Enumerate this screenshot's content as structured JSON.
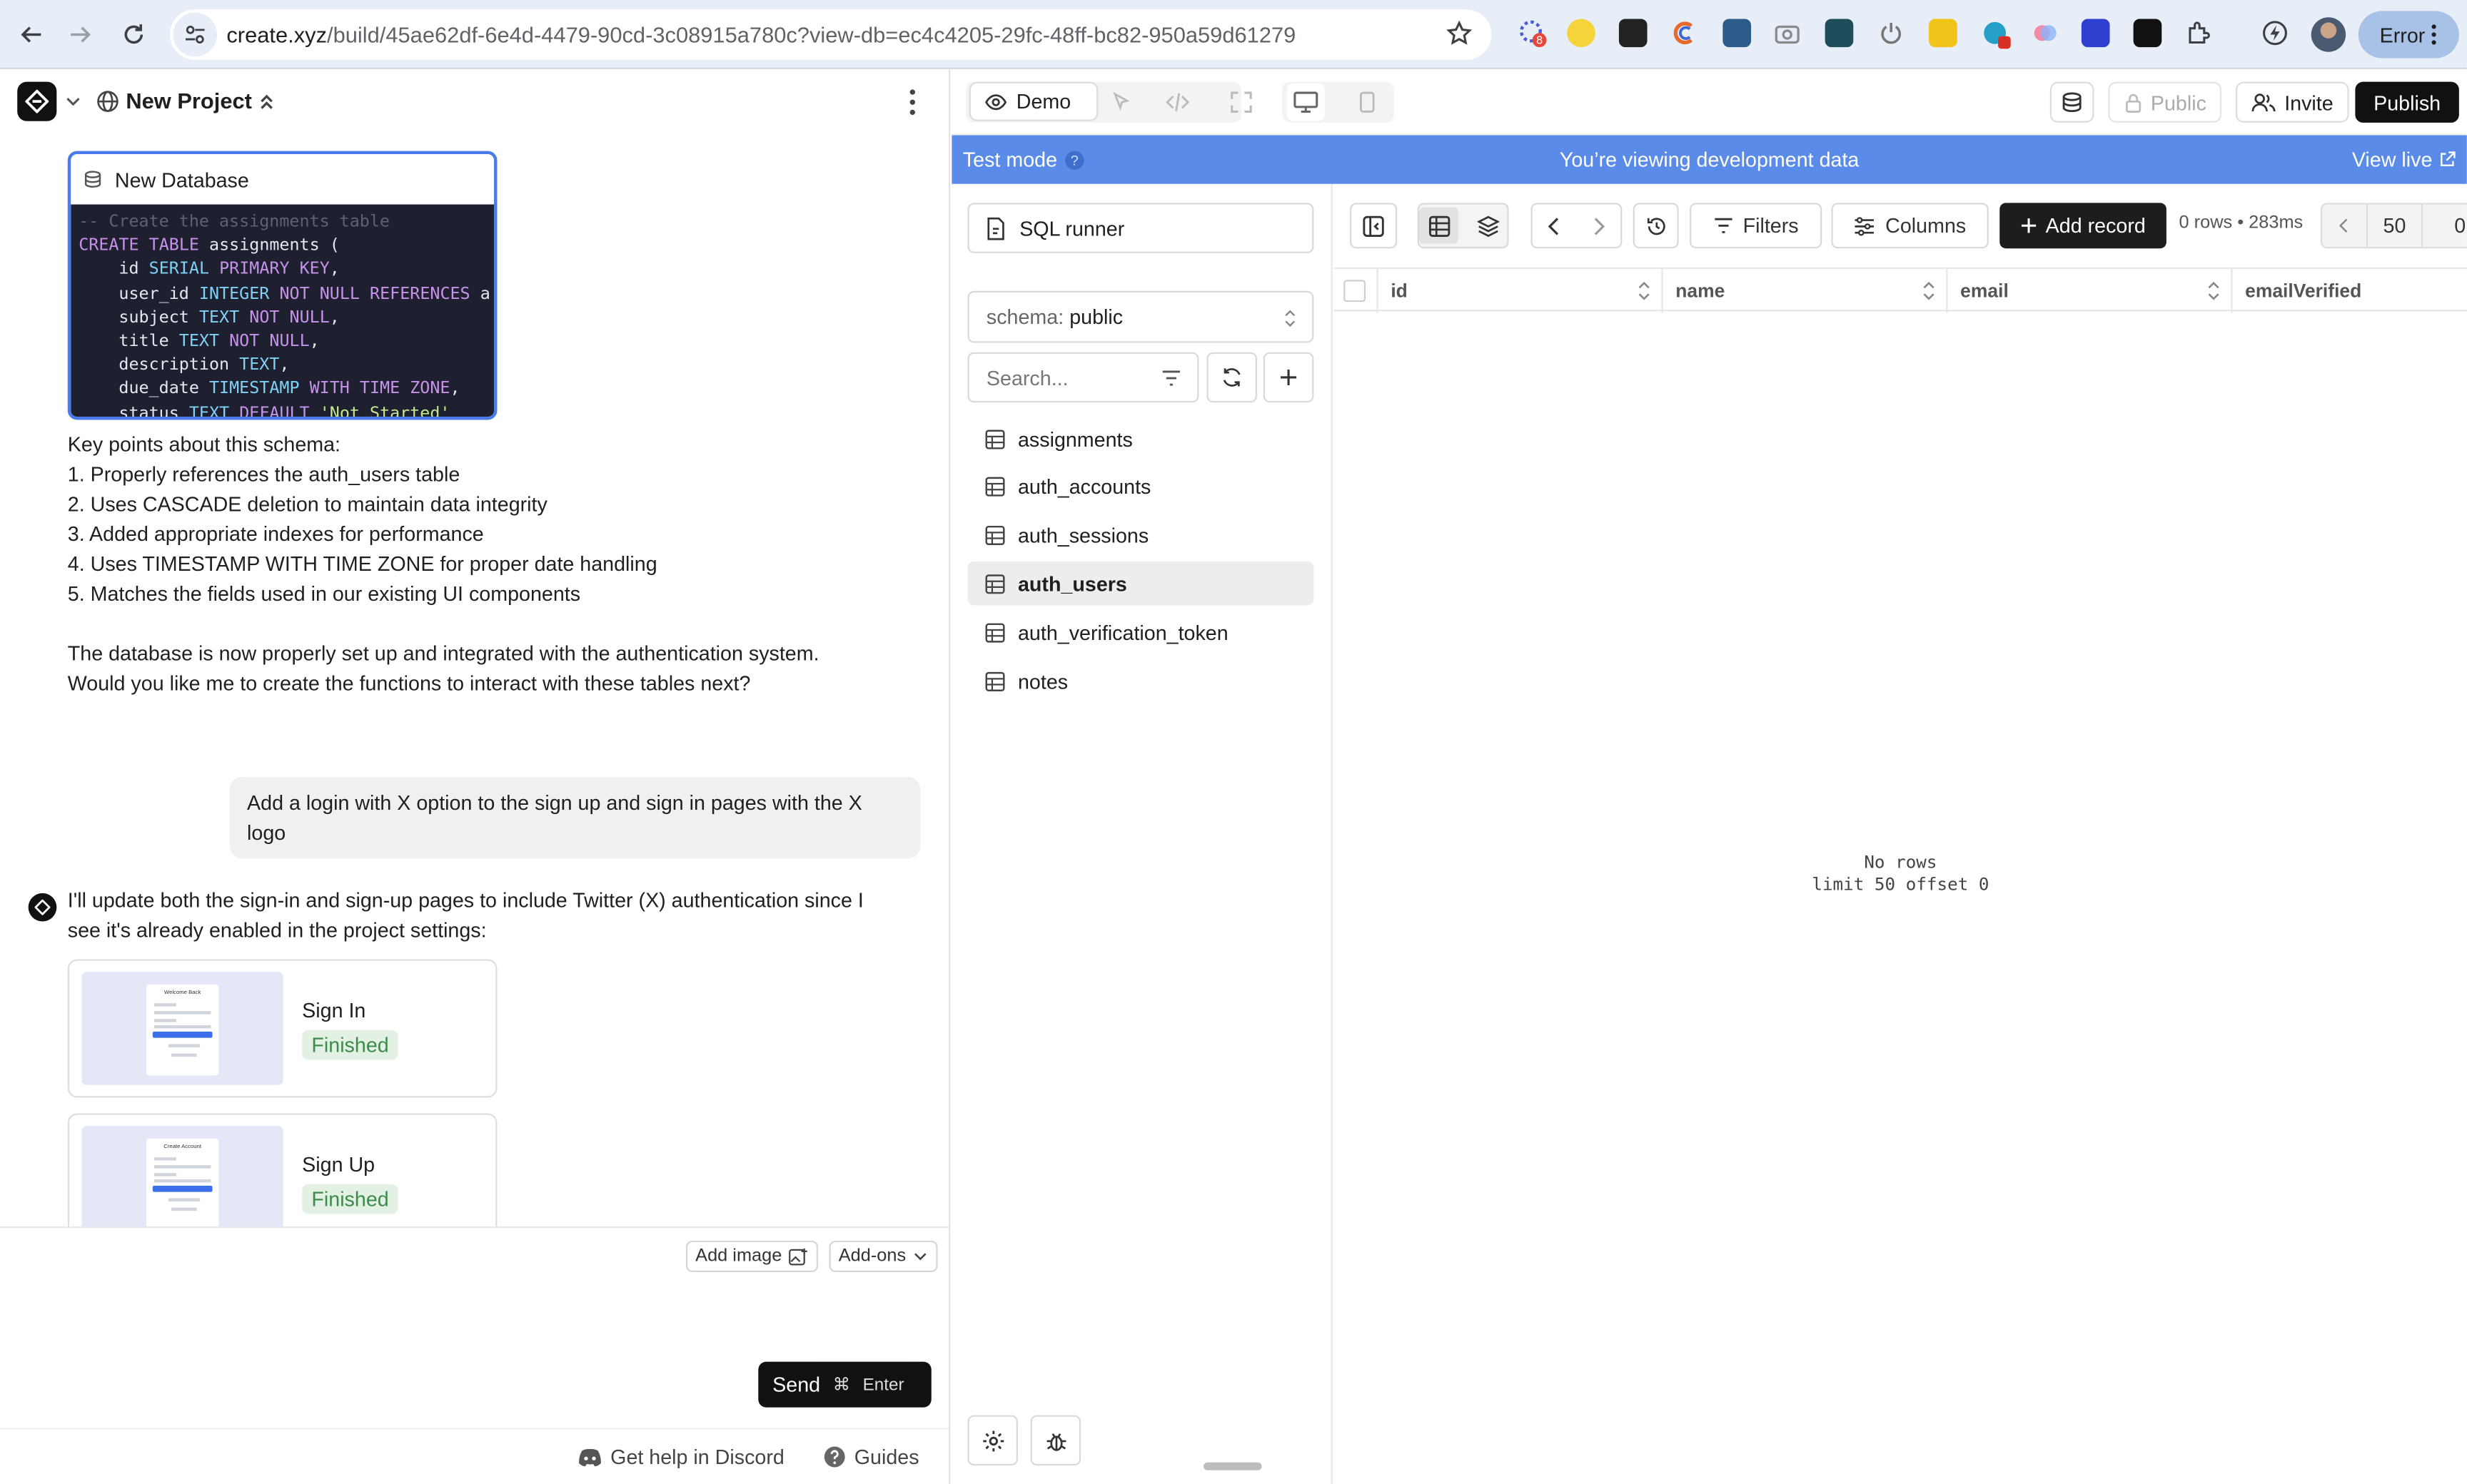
{
  "browser": {
    "url_domain": "create.xyz",
    "url_rest": "/build/45ae62df-6e4d-4479-90cd-3c08915a780c?view-db=ec4c4205-29fc-48ff-bc82-950a59d61279",
    "extension_badge": "8",
    "error_label": "Error"
  },
  "project": {
    "name": "New Project"
  },
  "chat": {
    "db_card_title": "New Database",
    "code_lines": [
      {
        "c": "cm",
        "t": "-- Create the assignments table"
      },
      {
        "c": "",
        "t": "CREATE TABLE assignments ("
      },
      {
        "c": "",
        "t": "    id SERIAL PRIMARY KEY,"
      },
      {
        "c": "",
        "t": "    user_id INTEGER NOT NULL REFERENCES a"
      },
      {
        "c": "",
        "t": "    subject TEXT NOT NULL,"
      },
      {
        "c": "",
        "t": "    title TEXT NOT NULL,"
      },
      {
        "c": "",
        "t": "    description TEXT,"
      },
      {
        "c": "",
        "t": "    due_date TIMESTAMP WITH TIME ZONE,"
      },
      {
        "c": "",
        "t": "    status TEXT DEFAULT 'Not Started'"
      }
    ],
    "key_points_title": "Key points about this schema:",
    "key_points": [
      "1. Properly references the auth_users table",
      "2. Uses CASCADE deletion to maintain data integrity",
      "3. Added appropriate indexes for performance",
      "4. Uses TIMESTAMP WITH TIME ZONE for proper date handling",
      "5. Matches the fields used in our existing UI components"
    ],
    "summary_line1": "The database is now properly set up and integrated with the authentication system.",
    "summary_line2": "Would you like me to create the functions to interact with these tables next?",
    "user_message": "Add a login with X option to the sign up and sign in pages with the X logo",
    "bot_line1": "I'll update both the sign-in and sign-up pages to include Twitter (X) authentication since I",
    "bot_line2": "see it's already enabled in the project settings:",
    "page_cards": [
      {
        "title": "Sign In",
        "status": "Finished",
        "thumb_title": "Welcome Back"
      },
      {
        "title": "Sign Up",
        "status": "Finished",
        "thumb_title": "Create Account"
      }
    ]
  },
  "composer": {
    "add_image": "Add image",
    "addons": "Add-ons",
    "send": "Send",
    "send_cmd": "⌘",
    "send_key": "Enter"
  },
  "help": {
    "discord": "Get help in Discord",
    "guides": "Guides"
  },
  "toolbar": {
    "demo": "Demo",
    "public": "Public",
    "invite": "Invite",
    "publish": "Publish"
  },
  "banner": {
    "test_mode": "Test mode",
    "center": "You’re viewing development data",
    "view_live": "View live"
  },
  "db": {
    "sql_runner": "SQL runner",
    "schema_label": "schema:",
    "schema_value": "public",
    "search_placeholder": "Search...",
    "tables": [
      "assignments",
      "auth_accounts",
      "auth_sessions",
      "auth_users",
      "auth_verification_token",
      "notes"
    ],
    "selected_table": "auth_users"
  },
  "grid": {
    "filters": "Filters",
    "columns_btn": "Columns",
    "add_record": "Add record",
    "rows_info": "0 rows • 283ms",
    "page_size": "50",
    "page_offset": "0",
    "columns": [
      "id",
      "name",
      "email",
      "emailVerified"
    ],
    "empty_line1": "No rows",
    "empty_line2": "limit 50 offset 0"
  }
}
